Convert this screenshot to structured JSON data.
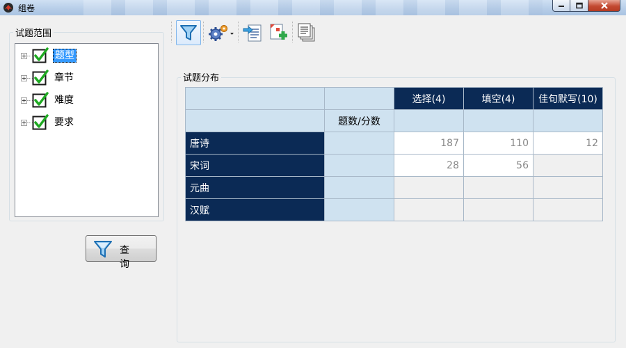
{
  "window": {
    "title": "组卷"
  },
  "scope": {
    "legend": "试题范围",
    "items": [
      {
        "label": "题型",
        "checked": true,
        "selected": true
      },
      {
        "label": "章节",
        "checked": true,
        "selected": false
      },
      {
        "label": "难度",
        "checked": true,
        "selected": false
      },
      {
        "label": "要求",
        "checked": true,
        "selected": false
      }
    ],
    "query_button": "查询"
  },
  "toolbar": {
    "buttons": [
      {
        "icon": "filter-icon",
        "active": true
      },
      {
        "icon": "settings-gears-icon",
        "has_dropdown": true
      },
      {
        "icon": "import-document-icon"
      },
      {
        "icon": "add-item-icon"
      },
      {
        "icon": "copy-pages-icon"
      }
    ]
  },
  "distribution": {
    "legend": "试题分布",
    "column_headers": [
      "选择(4)",
      "填空(4)",
      "佳句默写(10)"
    ],
    "sub_header": "题数/分数",
    "rows": [
      {
        "label": "唐诗",
        "values": [
          "187",
          "110",
          "12"
        ]
      },
      {
        "label": "宋词",
        "values": [
          "28",
          "56",
          ""
        ]
      },
      {
        "label": "元曲",
        "values": [
          "",
          "",
          ""
        ]
      },
      {
        "label": "汉赋",
        "values": [
          "",
          "",
          ""
        ]
      }
    ]
  },
  "colors": {
    "dark_cell": "#0b2a55",
    "header_cell": "#cfe2f0",
    "selection": "#3399ff"
  }
}
